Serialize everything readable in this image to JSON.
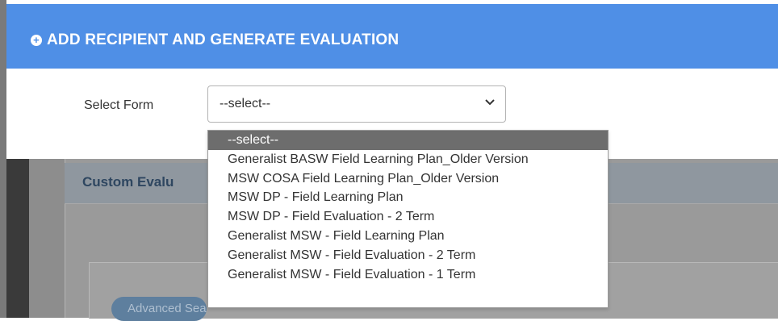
{
  "modal": {
    "title": "ADD RECIPIENT AND GENERATE EVALUATION",
    "form_label": "Select Form",
    "select_value": "--select--"
  },
  "dropdown": {
    "options": [
      "--select--",
      "Generalist BASW Field Learning Plan_Older Version",
      "MSW COSA Field Learning Plan_Older Version",
      "MSW DP - Field Learning Plan",
      "MSW DP - Field Evaluation - 2 Term",
      "Generalist MSW - Field Learning Plan",
      "Generalist MSW - Field Evaluation - 2 Term",
      "Generalist MSW - Field Evaluation - 1 Term"
    ],
    "selected_index": 0
  },
  "background": {
    "card_title": "Custom Evalu",
    "advanced_search_label": "Advanced Search »"
  },
  "colors": {
    "header": "#4f8fe6",
    "selected_option": "#6d6d6d"
  },
  "icons": {
    "title_icon": "plus-circle-icon",
    "select_icon": "chevron-down-icon"
  }
}
